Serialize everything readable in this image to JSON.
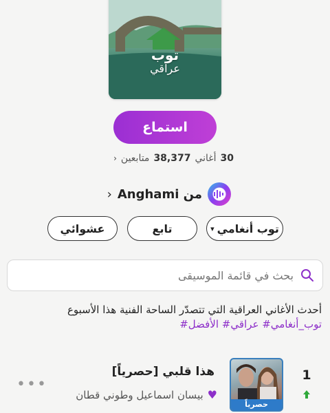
{
  "cover": {
    "title": "توب",
    "subtitle": "عراقي"
  },
  "play_button": {
    "label": "استماع"
  },
  "stats": {
    "songs_count": "30",
    "songs_label": "أغاني",
    "followers_count": "38,377",
    "followers_label": "متابعين",
    "chevron": "‹"
  },
  "source": {
    "label": "من Anghami",
    "chevron": "‹",
    "icon": "anghami-logo-icon"
  },
  "actions": {
    "sort_label": "توب أنغامي",
    "sort_icon": "▾",
    "follow_label": "تابع",
    "shuffle_label": "عشوائي"
  },
  "search": {
    "placeholder": "بحث في قائمة الموسيقى",
    "icon": "search-icon"
  },
  "description": {
    "text": "أحدث الأغاني العراقية التي تتصدّر الساحة الفنية هذا الأسبوع",
    "tags": "توب_أنغامي# عراقي# الأفضل#"
  },
  "tracks": [
    {
      "rank": "1",
      "trend": "up",
      "title": "هذا قلبي [حصرياً]",
      "artist": "بيسان اسماعيل وطوني قطان",
      "badge": "حصرياً",
      "more": "•••"
    }
  ],
  "colors": {
    "accent": "#9b2fd3",
    "badge": "#2e7bc9",
    "trend_up": "#2fa83a"
  }
}
